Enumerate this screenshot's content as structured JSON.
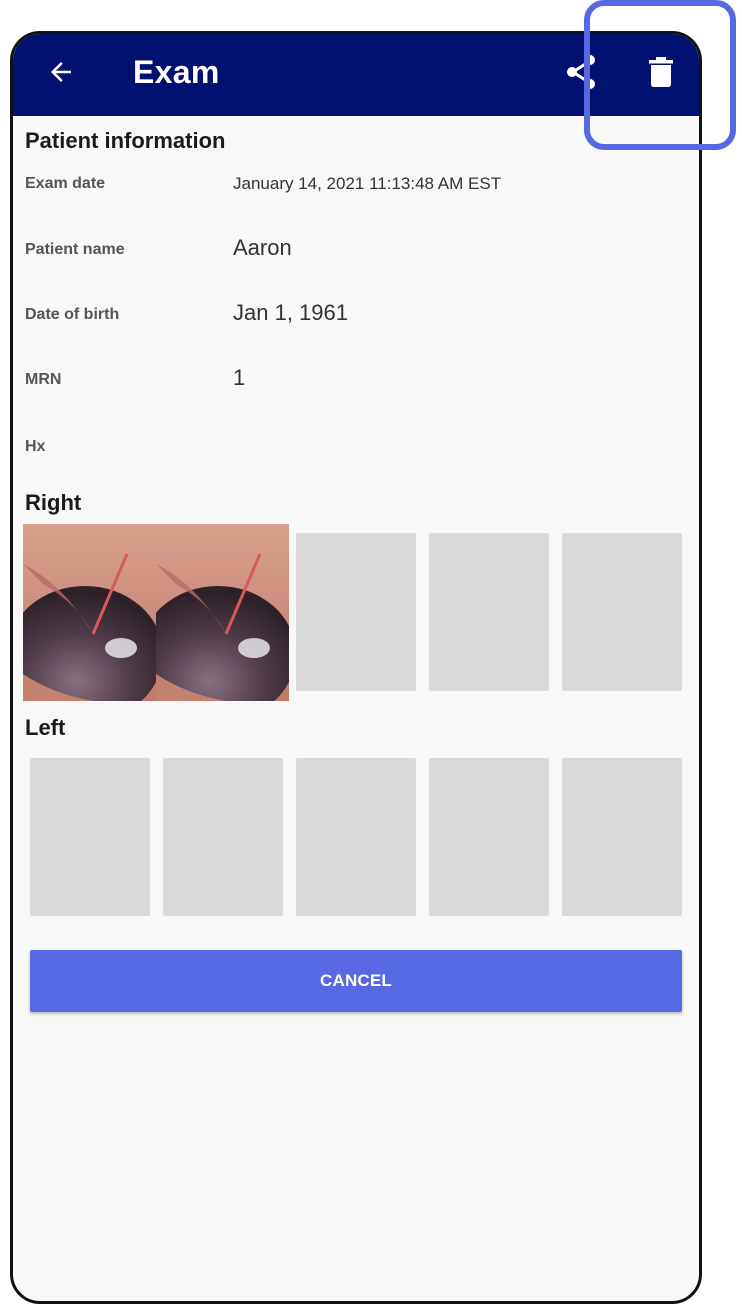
{
  "appbar": {
    "title": "Exam",
    "icons": {
      "back": "arrow-left-icon",
      "share": "share-icon",
      "delete": "trash-icon"
    },
    "background_color": "#001172"
  },
  "patient_info": {
    "heading": "Patient information",
    "fields": [
      {
        "label": "Exam date",
        "value": "January 14, 2021 11:13:48 AM EST"
      },
      {
        "label": "Patient name",
        "value": "Aaron"
      },
      {
        "label": "Date of birth",
        "value": "Jan 1, 1961"
      },
      {
        "label": "MRN",
        "value": "1"
      },
      {
        "label": "Hx",
        "value": ""
      }
    ]
  },
  "right": {
    "heading": "Right",
    "images_captured": 2,
    "slots_total": 5
  },
  "left": {
    "heading": "Left",
    "images_captured": 0,
    "slots_total": 5
  },
  "actions": {
    "cancel_label": "CANCEL",
    "accent_color": "#5668e2"
  }
}
